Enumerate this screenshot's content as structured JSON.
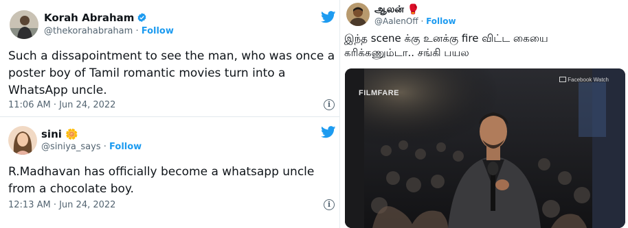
{
  "tweets": [
    {
      "name": "Korah Abraham",
      "verified": true,
      "handle": "@thekorahabraham",
      "separator": "·",
      "follow": "Follow",
      "text": "Such a dissapointment to see the man, who was once a poster boy of Tamil romantic movies turn into a WhatsApp uncle.",
      "time": "11:06 AM · Jun 24, 2022"
    },
    {
      "name": "sini 🌼",
      "handle": "@siniya_says",
      "separator": "·",
      "follow": "Follow",
      "text": "R.Madhavan has officially become a whatsapp uncle from a chocolate boy.",
      "time": "12:13 AM · Jun 24, 2022"
    },
    {
      "name": "ஆலன் 🥊",
      "handle": "@AalenOff",
      "separator": "·",
      "follow": "Follow",
      "text": "இந்த scene க்கு உனக்கு fire விட்ட கையை கரிக்கணும்டா.. சங்கி பயல",
      "media": {
        "logo": "FILMFARE",
        "watermark": "Facebook Watch"
      }
    }
  ],
  "colors": {
    "accent": "#1d9bf0",
    "secondary_text": "#536471",
    "divider": "#e1e8ed"
  },
  "icons": [
    "twitter-bird-icon",
    "verified-badge-icon",
    "info-icon"
  ]
}
